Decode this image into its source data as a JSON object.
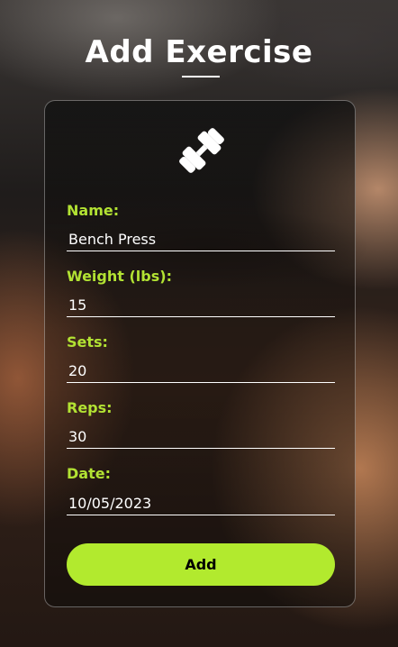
{
  "page": {
    "title": "Add Exercise",
    "accent_color": "#b2ea2e",
    "icon": "dumbbell-icon"
  },
  "form": {
    "name": {
      "label": "Name:",
      "value": "Bench Press"
    },
    "weight": {
      "label": "Weight (lbs):",
      "value": "15"
    },
    "sets": {
      "label": "Sets:",
      "value": "20"
    },
    "reps": {
      "label": "Reps:",
      "value": "30"
    },
    "date": {
      "label": "Date:",
      "value": "10/05/2023"
    },
    "submit_label": "Add"
  }
}
